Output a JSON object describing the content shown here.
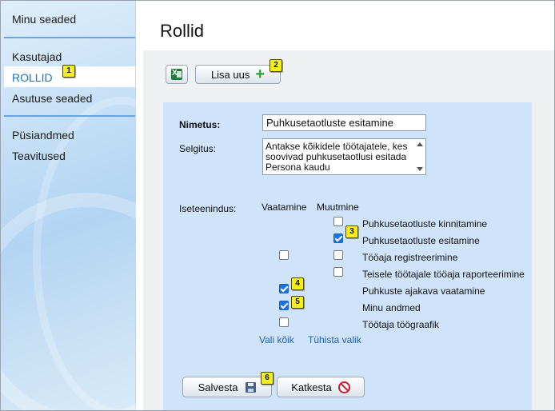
{
  "sidebar": {
    "items": [
      {
        "label": "Minu seaded"
      },
      {
        "label": "Kasutajad"
      },
      {
        "label": "ROLLID"
      },
      {
        "label": "Asutuse seaded"
      },
      {
        "label": "Püsiandmed"
      },
      {
        "label": "Teavitused"
      }
    ]
  },
  "page": {
    "title": "Rollid"
  },
  "toolbar": {
    "add_label": "Lisa uus"
  },
  "form": {
    "name_label": "Nimetus:",
    "name_value": "Puhkusetaotluste esitamine",
    "desc_label": "Selgitus:",
    "desc_value": "Antakse kõikidele töötajatele, kes soovivad puhkusetaotlusi esitada Persona kaudu",
    "selfservice_label": "Iseteenindus:",
    "col_view": "Vaatamine",
    "col_edit": "Muutmine",
    "permissions": [
      {
        "label": "Puhkusetaotluste kinnitamine",
        "view": null,
        "edit": false
      },
      {
        "label": "Puhkusetaotluste esitamine",
        "view": null,
        "edit": true
      },
      {
        "label": "Tööaja registreerimine",
        "view": false,
        "edit": false
      },
      {
        "label": "Teisele töötajale tööaja raporteerimine",
        "view": null,
        "edit": false
      },
      {
        "label": "Puhkuste ajakava vaatamine",
        "view": true,
        "edit": null
      },
      {
        "label": "Minu andmed",
        "view": true,
        "edit": null
      },
      {
        "label": "Töötaja töögraafik",
        "view": false,
        "edit": null
      }
    ],
    "select_all": "Vali kõik",
    "clear_all": "Tühista valik"
  },
  "actions": {
    "save_label": "Salvesta",
    "cancel_label": "Katkesta"
  },
  "badges": [
    "1",
    "2",
    "3",
    "4",
    "5",
    "6"
  ],
  "colors": {
    "active_link": "#1d72c9",
    "panel": "#cfe3fb",
    "badge": "#f7ef1a",
    "check": "#1a73e8"
  },
  "icons": [
    "excel-icon",
    "plus-icon",
    "floppy-icon",
    "no-entry-icon"
  ]
}
